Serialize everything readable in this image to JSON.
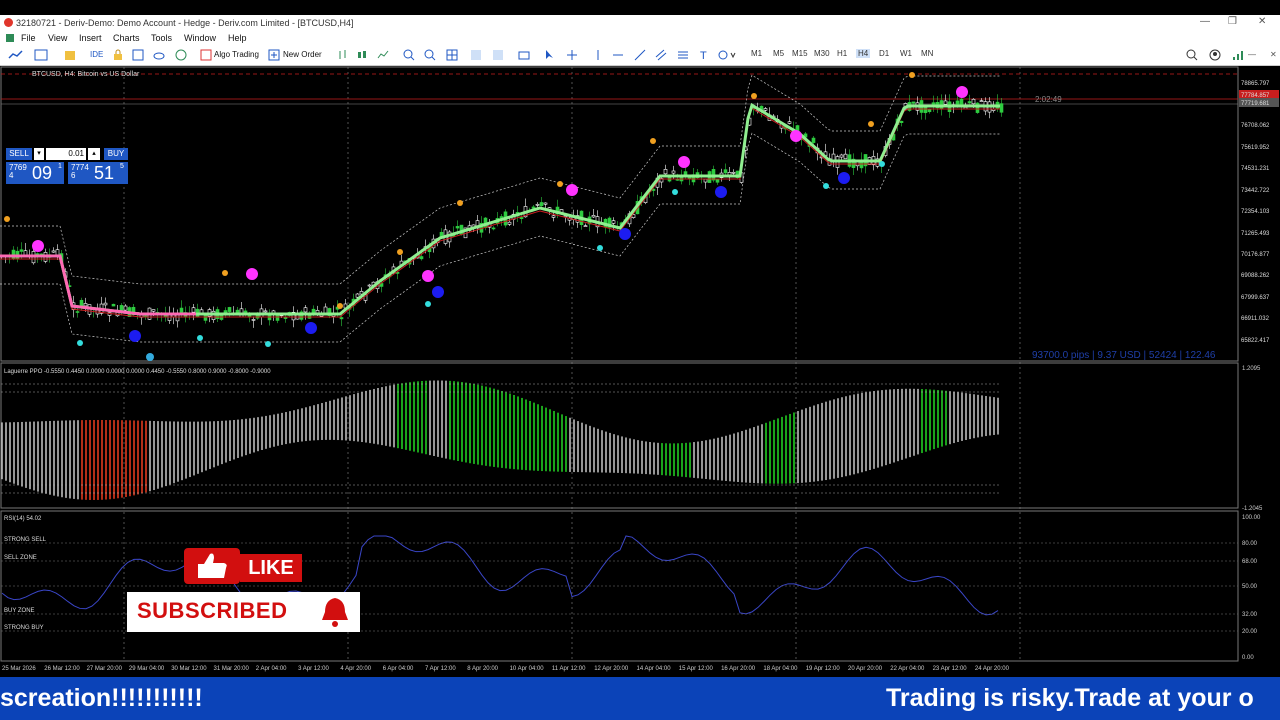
{
  "window": {
    "title": "32180721 - Deriv-Demo: Demo Account - Hedge - Deriv.com Limited - [BTCUSD,H4]",
    "minimize": "—",
    "maximize": "❐",
    "close": "✕"
  },
  "menu": {
    "items": [
      "File",
      "View",
      "Insert",
      "Charts",
      "Tools",
      "Window",
      "Help"
    ]
  },
  "toolbar": {
    "algo_trading": "Algo Trading",
    "new_order": "New Order",
    "ide": "IDE",
    "timeframes": [
      "M1",
      "M5",
      "M15",
      "M30",
      "H1",
      "H4",
      "D1",
      "W1",
      "MN"
    ],
    "active_timeframe": "H4"
  },
  "chart": {
    "symbol_label": "BTCUSD, H4:  Bitcoin vs US Dollar",
    "sell_label": "SELL",
    "buy_label": "BUY",
    "lot": "0.01",
    "bid": {
      "prefix": "77694",
      "big": "09",
      "sup": "1"
    },
    "ask": {
      "prefix": "77746",
      "big": "51",
      "sup": "5"
    },
    "countdown": "2:02:49",
    "info_line": "93700.0 pips | 9.37 USD | 52424 | 122.46",
    "price_labels": [
      "78865.797",
      "77784.857",
      "77719.681",
      "76708.062",
      "75619.952",
      "74531.231",
      "73442.722",
      "72354.103",
      "71265.493",
      "70176.877",
      "69088.262",
      "67999.637",
      "66911.032",
      "65822.417"
    ],
    "time_labels": [
      "25 Mar 2026",
      "26 Mar 12:00",
      "27 Mar 20:00",
      "29 Mar 04:00",
      "30 Mar 12:00",
      "31 Mar 20:00",
      "2 Apr 04:00",
      "3 Apr 12:00",
      "4 Apr 20:00",
      "6 Apr 04:00",
      "7 Apr 12:00",
      "8 Apr 20:00",
      "10 Apr 04:00",
      "11 Apr 12:00",
      "12 Apr 20:00",
      "14 Apr 04:00",
      "15 Apr 12:00",
      "16 Apr 20:00",
      "18 Apr 04:00",
      "19 Apr 12:00",
      "20 Apr 20:00",
      "22 Apr 04:00",
      "23 Apr 12:00",
      "24 Apr 20:00"
    ],
    "colors": {
      "bull": "#2ecc40",
      "bear": "#ffffff",
      "baseline": "#90ee90",
      "pink": "#ff69b4",
      "red_line": "#c81e1e"
    }
  },
  "ppo": {
    "label": "Laguerre PPO -0.5550 0.4450 0.0000 0.0000 0.0000 0.4450 -0.5550 0.8000 0.9000 -0.8000 -0.9000",
    "scale": [
      "1.2095",
      "-1.2045"
    ]
  },
  "rsi": {
    "label": "RSI(14) 54.02",
    "zones": [
      "STRONG SELL",
      "SELL ZONE",
      "BUY ZONE",
      "STRONG BUY"
    ],
    "scale": [
      "100.00",
      "80.00",
      "68.00",
      "50.00",
      "32.00",
      "20.00",
      "0.00"
    ]
  },
  "overlay": {
    "like": "LIKE",
    "subscribed": "SUBSCRIBED"
  },
  "ticker": {
    "left": "screation!!!!!!!!!!!",
    "right": "Trading is risky.Trade at your o"
  }
}
